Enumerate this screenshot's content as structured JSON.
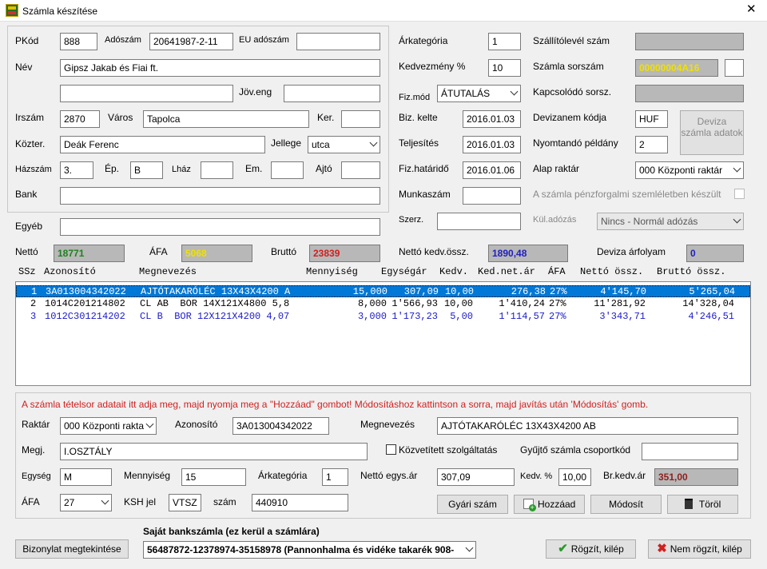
{
  "window": {
    "title": "Számla készítése",
    "close": "✕",
    "icon": "app-icon"
  },
  "top": {
    "pkod_label": "PKód",
    "pkod": "888",
    "adoszam_label": "Adószám",
    "adoszam": "20641987-2-11",
    "eu_label": "EU adószám",
    "eu": "",
    "nev_label": "Név",
    "nev": "Gipsz Jakab és Fiai ft.",
    "nev2": "",
    "joveng_label": "Jöv.eng",
    "joveng": "",
    "irszam_label": "Irszám",
    "irszam": "2870",
    "varos_label": "Város",
    "varos": "Tapolca",
    "ker_label": "Ker.",
    "ker": "",
    "kozter_label": "Közter.",
    "kozter": "Deák Ferenc",
    "jellege_label": "Jellege",
    "jellege": "utca",
    "hazszam_label": "Házszám",
    "hazszam": "3.",
    "ep_label": "Ép.",
    "ep": "B",
    "lhaz_label": "Lház",
    "lhaz": "",
    "em_label": "Em.",
    "em": "",
    "ajto_label": "Ajtó",
    "ajto": "",
    "bank_label": "Bank",
    "bank": "",
    "egyeb_label": "Egyéb",
    "egyeb": "",
    "arkat_label": "Árkategória",
    "arkat": "1",
    "kedv_label": "Kedvezmény %",
    "kedv": "10",
    "fizmod_label": "Fiz.mód",
    "fizmod": "ÁTUTALÁS",
    "bizkelte_label": "Biz. kelte",
    "bizkelte": "2016.01.03",
    "telj_label": "Teljesítés",
    "telj": "2016.01.03",
    "fizhat_label": "Fiz.határidő",
    "fizhat": "2016.01.06",
    "munkaszam_label": "Munkaszám",
    "munkaszam": "",
    "szerz_label": "Szerz.",
    "szerz": "",
    "szallito_label": "Szállítólevél szám",
    "szallito": "",
    "sorszam_label": "Számla sorszám",
    "sorszam": "00000004A16",
    "sorszam2": "",
    "kapcs_label": "Kapcsolódó sorsz.",
    "kapcs": "",
    "deviza_label": "Devizanem kódja",
    "deviza": "HUF",
    "deviza_btn": "Deviza számla adatok",
    "nyomt_label": "Nyomtandó példány",
    "nyomt": "2",
    "raktar_label": "Alap raktár",
    "raktar": "000 Központi raktár",
    "penzforg_label": "A számla pénzforgalmi szemléletben készült",
    "kuladozas_label": "Kül.adózás",
    "kuladozas": "Nincs - Normál adózás",
    "netto_label": "Nettó",
    "netto": "18771",
    "afa_label": "ÁFA",
    "afa": "5068",
    "brutto_label": "Bruttó",
    "brutto": "23839",
    "nettokedv_label": "Nettó kedv.össz.",
    "nettokedv": "1890,48",
    "devarf_label": "Deviza árfolyam",
    "devarf": "0"
  },
  "grid": {
    "headers": [
      "SSz",
      "Azonosító",
      "Megnevezés",
      "Mennyiség",
      "Egységár",
      "Kedv.",
      "Ked.net.ár",
      "ÁFA",
      "Nettó össz.",
      "Bruttó össz."
    ],
    "rows": [
      [
        "1",
        "3A013004342022",
        "AJTÓTAKARÓLÉC 13X43X4200 A",
        "15,000",
        "307,09",
        "10,00",
        "276,38",
        "27%",
        "4'145,70",
        "5'265,04"
      ],
      [
        "2",
        "1014C201214802",
        "CL AB  BOR 14X121X4800 5,8",
        "8,000",
        "1'566,93",
        "10,00",
        "1'410,24",
        "27%",
        "11'281,92",
        "14'328,04"
      ],
      [
        "3",
        "1012C301214202",
        "CL B  BOR 12X121X4200 4,07",
        "3,000",
        "1'173,23",
        "5,00",
        "1'114,57",
        "27%",
        "3'343,71",
        "4'246,51"
      ]
    ],
    "row_colors": [
      "#ffffff",
      "#000000",
      "#1a1acc"
    ]
  },
  "item": {
    "hint": "A számla tételsor adatait itt adja meg, majd nyomja meg a \"Hozzáad\" gombot! Módosításhoz kattintson a sorra, majd javítás után 'Módosítás' gomb.",
    "raktar_label": "Raktár",
    "raktar": "000 Központi rakta",
    "azon_label": "Azonosító",
    "azon": "3A013004342022",
    "megnev_label": "Megnevezés",
    "megnev": "AJTÓTAKARÓLÉC 13X43X4200 AB",
    "megj_label": "Megj.",
    "megj": "I.OSZTÁLY",
    "kozvet_label": "Közvetített szolgáltatás",
    "gyujto_label": "Gyűjtő számla csoportkód",
    "gyujto": "",
    "egyseg_label": "Egység",
    "egyseg": "M",
    "menny_label": "Mennyiség",
    "menny": "15",
    "arkat_label": "Árkategória",
    "arkat": "1",
    "nettoegys_label": "Nettó egys.ár",
    "nettoegys": "307,09",
    "kedv_label": "Kedv. %",
    "kedv": "10,00",
    "brkedv_label": "Br.kedv.ár",
    "brkedv": "351,00",
    "afa_label": "ÁFA",
    "afa": "27",
    "ksh_label": "KSH jel",
    "ksh": "VTSZ",
    "szam_label": "szám",
    "szam": "440910",
    "gyari_btn": "Gyári szám",
    "hozzaad_btn": "Hozzáad",
    "modosit_btn": "Módosít",
    "torol_btn": "Töröl"
  },
  "footer": {
    "bizonylat_btn": "Bizonylat megtekintése",
    "bankszamla_label": "Saját bankszámla (ez kerül a számlára)",
    "bankszamla": "56487872-12378974-35158978 (Pannonhalma és vidéke takarék 908-",
    "rogzit_btn": "Rögzít, kilép",
    "nemrogzit_btn": "Nem rögzít, kilép"
  }
}
